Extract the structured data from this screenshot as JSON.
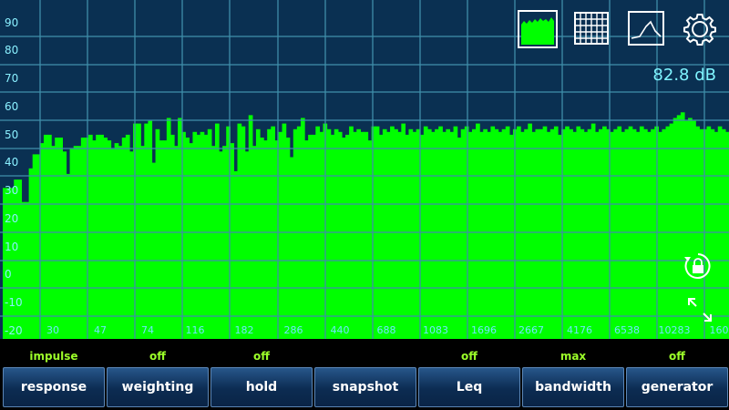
{
  "display": {
    "level_readout": "82.8 dB",
    "y_axis_labels": [
      "90",
      "80",
      "70",
      "60",
      "50",
      "40",
      "30",
      "20",
      "10",
      "0",
      "-10",
      "-20"
    ],
    "x_axis_labels": [
      "30",
      "47",
      "74",
      "116",
      "182",
      "286",
      "440",
      "688",
      "1083",
      "1696",
      "2667",
      "4176",
      "6538",
      "10283",
      "160"
    ],
    "colors": {
      "background": "#0a3052",
      "grid": "#3f8faa",
      "spectrum": "#00ff00",
      "label": "#6fe6ff",
      "status": "#9cff29"
    },
    "icons": {
      "spectrum_view": "spectrum-view-icon",
      "spectrogram_view": "spectrogram-grid-icon",
      "curve_view": "curve-view-icon",
      "settings": "gear-icon",
      "rotation_lock": "rotation-lock-icon",
      "fullscreen": "expand-arrows-icon"
    }
  },
  "chart_data": {
    "type": "bar",
    "ylim": [
      -20,
      95
    ],
    "values": [
      31,
      31,
      31,
      34,
      34,
      26,
      26,
      38,
      43,
      43,
      47,
      50,
      50,
      46,
      49,
      49,
      44,
      36,
      45,
      46,
      46,
      49,
      49,
      50,
      48,
      50,
      50,
      49,
      48,
      45,
      47,
      46,
      49,
      50,
      44,
      54,
      54,
      46,
      54,
      55,
      40,
      52,
      48,
      48,
      56,
      50,
      46,
      56,
      51,
      49,
      47,
      51,
      50,
      51,
      50,
      52,
      46,
      54,
      44,
      46,
      53,
      47,
      37,
      54,
      53,
      44,
      57,
      46,
      52,
      49,
      48,
      52,
      53,
      48,
      51,
      54,
      49,
      42,
      52,
      53,
      56,
      48,
      50,
      50,
      53,
      51,
      54,
      52,
      50,
      52,
      51,
      49,
      50,
      53,
      51,
      52,
      51,
      51,
      48,
      53,
      53,
      50,
      52,
      51,
      53,
      52,
      51,
      54,
      50,
      52,
      51,
      52,
      50,
      53,
      52,
      51,
      52,
      53,
      51,
      52,
      51,
      53,
      49,
      52,
      53,
      51,
      52,
      54,
      51,
      52,
      51,
      53,
      52,
      51,
      52,
      53,
      50,
      52,
      53,
      51,
      52,
      54,
      51,
      52,
      52,
      53,
      51,
      52,
      53,
      50,
      52,
      53,
      52,
      51,
      53,
      52,
      51,
      52,
      54,
      51,
      52,
      53,
      52,
      51,
      52,
      53,
      51,
      52,
      53,
      52,
      51,
      53,
      52,
      51,
      52,
      53,
      51,
      52,
      53,
      54,
      56,
      57,
      58,
      55,
      56,
      55,
      53,
      52,
      52,
      53,
      52,
      51,
      53,
      52,
      51
    ]
  },
  "controls": {
    "status": [
      "impulse",
      "off",
      "off",
      "",
      "off",
      "max",
      "off"
    ],
    "buttons": [
      "response",
      "weighting",
      "hold",
      "snapshot",
      "Leq",
      "bandwidth",
      "generator"
    ]
  }
}
